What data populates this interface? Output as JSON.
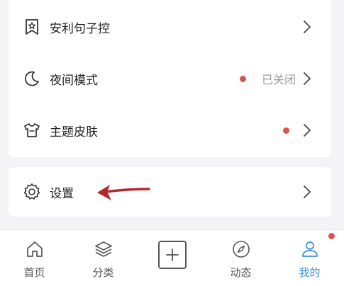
{
  "colors": {
    "accent": "#3d8ee0",
    "badge_red": "#d9534f",
    "text_primary": "#222222",
    "text_secondary": "#9a9a9a",
    "arrow": "#b52828"
  },
  "menu": {
    "items": [
      {
        "icon": "bookmark-star-icon",
        "label": "安利句子控",
        "has_dot": false,
        "status": ""
      },
      {
        "icon": "moon-icon",
        "label": "夜间模式",
        "has_dot": true,
        "status": "已关闭"
      },
      {
        "icon": "tshirt-icon",
        "label": "主题皮肤",
        "has_dot": true,
        "status": ""
      }
    ],
    "settings": {
      "icon": "gear-icon",
      "label": "设置"
    }
  },
  "tabbar": {
    "tabs": [
      {
        "icon": "home-icon",
        "label": "首页",
        "active": false
      },
      {
        "icon": "layers-icon",
        "label": "分类",
        "active": false
      },
      {
        "icon": "plus-icon",
        "label": "",
        "active": false
      },
      {
        "icon": "compass-icon",
        "label": "动态",
        "active": false
      },
      {
        "icon": "user-icon",
        "label": "我的",
        "active": true,
        "has_dot": true
      }
    ]
  }
}
